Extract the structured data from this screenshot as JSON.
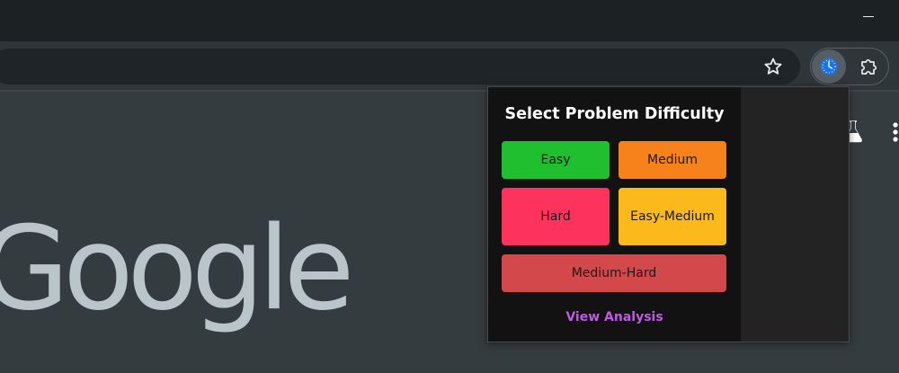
{
  "browser": {
    "logo_text": "Google",
    "icons": [
      "bookmark-star-icon",
      "extension-clock-icon",
      "extensions-puzzle-icon",
      "labs-flask-icon",
      "more-kebab-icon",
      "minimize-icon"
    ]
  },
  "popup": {
    "title": "Select Problem Difficulty",
    "buttons": {
      "easy": "Easy",
      "medium": "Medium",
      "hard": "Hard",
      "easy_medium": "Easy-Medium",
      "medium_hard": "Medium-Hard"
    },
    "link": "View Analysis"
  },
  "colors": {
    "easy": "#1fbf2f",
    "medium": "#f7821b",
    "hard": "#fd335d",
    "easy_medium": "#fbb91b",
    "medium_hard": "#d3484b",
    "link": "#c158e8",
    "extension_icon": "#1a73e8"
  }
}
